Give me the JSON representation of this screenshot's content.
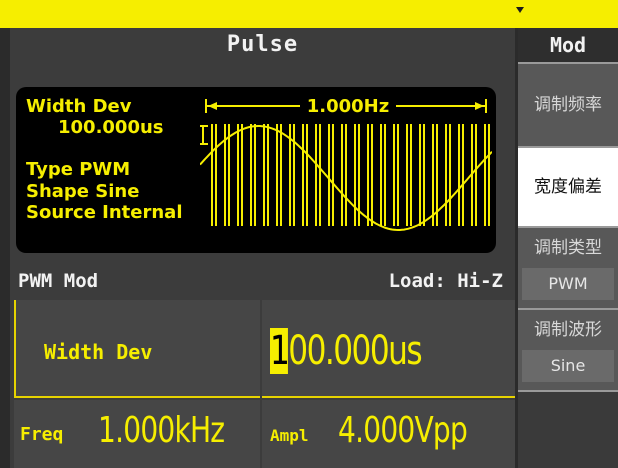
{
  "header": {
    "title": "Pulse"
  },
  "menu": {
    "title": "Mod",
    "items": [
      {
        "label": "调制频率"
      },
      {
        "label": "宽度偏差",
        "selected": true
      },
      {
        "label": "调制类型",
        "value": "PWM"
      },
      {
        "label": "调制波形",
        "value": "Sine"
      }
    ]
  },
  "params": {
    "width_dev_label": "Width Dev",
    "width_dev_value": "100.000us",
    "type_line": "Type PWM",
    "shape_line": "Shape  Sine",
    "source_line": "Source Internal",
    "freq_marker": "1.000Hz"
  },
  "status": {
    "mod_label": "PWM Mod",
    "load_label": "Load: Hi-Z"
  },
  "fields": {
    "width_dev": {
      "label": "Width Dev",
      "cursor_digit": "1",
      "value_rest": "00.000us"
    },
    "freq": {
      "label": "Freq",
      "value": "1.000kHz"
    },
    "ampl": {
      "label": "Ampl",
      "value": "4.000Vpp"
    }
  },
  "colors": {
    "accent": "#f6ee00",
    "background": "#3c3c3c",
    "selected_menu": "#ffffff"
  }
}
